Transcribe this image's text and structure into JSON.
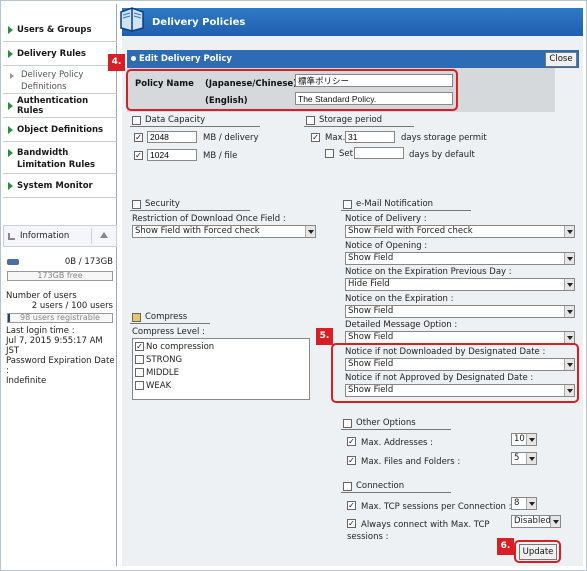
{
  "sidebar": {
    "items": [
      {
        "label": "Users & Groups"
      },
      {
        "label": "Delivery Rules"
      },
      {
        "label": "Delivery Policy Definitions"
      },
      {
        "label": "Authentication Rules"
      },
      {
        "label": "Object Definitions"
      },
      {
        "label": "Bandwidth Limitation Rules"
      },
      {
        "label": "System Monitor"
      }
    ],
    "info": {
      "title": "Information",
      "disk_used": "0B /  173GB",
      "disk_free": "173GB free",
      "users_label": "Number of users",
      "users_value": "2 users / 100 users",
      "users_registrable": "98 users registrable",
      "users_fraction": 0.02,
      "login_label": "Last login time :",
      "login_value": "Jul 7, 2015 9:55:17 AM JST",
      "pwd_label": "Password Expiration Date :",
      "pwd_value": "Indefinite"
    }
  },
  "header": {
    "title": "Delivery Policies"
  },
  "edit": {
    "title": "Edit Delivery Policy",
    "close_label": "Close",
    "policy_name_label": "Policy Name",
    "jp_label": "(Japanese/Chinese)",
    "en_label": "(English)",
    "jp_value": "標準ポリシー",
    "en_value": "The Standard Policy."
  },
  "capacity": {
    "title": "Data Capacity",
    "delivery_value": "2048",
    "delivery_unit": "MB / delivery",
    "file_value": "1024",
    "file_unit": "MB / file"
  },
  "storage": {
    "title": "Storage period",
    "max_label": "Max.",
    "max_value": "31",
    "max_unit": "days storage permit",
    "set_label": "Set",
    "set_value": "",
    "set_unit": "days by default"
  },
  "security": {
    "title": "Security",
    "field_label": "Restriction of Download Once Field :",
    "field_value": "Show Field with Forced check"
  },
  "compress": {
    "title": "Compress",
    "level_label": "Compress Level :",
    "options": [
      "No compression",
      "STRONG",
      "MIDDLE",
      "WEAK"
    ]
  },
  "email": {
    "title": "e-Mail Notification",
    "fields": [
      {
        "label": "Notice of Delivery :",
        "value": "Show Field with Forced check"
      },
      {
        "label": "Notice of Opening :",
        "value": "Show Field"
      },
      {
        "label": "Notice on the Expiration Previous Day :",
        "value": "Hide Field"
      },
      {
        "label": "Notice on the Expiration :",
        "value": "Show Field"
      },
      {
        "label": "Detailed Message Option :",
        "value": "Show Field"
      },
      {
        "label": "Notice if not Downloaded by Designated Date :",
        "value": "Show Field"
      },
      {
        "label": "Notice if not Approved by Designated Date :",
        "value": "Show Field"
      }
    ]
  },
  "other": {
    "title": "Other Options",
    "addr_label": "Max. Addresses :",
    "addr_value": "10",
    "files_label": "Max. Files and Folders :",
    "files_value": "5"
  },
  "connection": {
    "title": "Connection",
    "tcp_label": "Max. TCP sessions per Connection :",
    "tcp_value": "8",
    "always_label_1": "Always connect with Max. TCP",
    "always_label_2": "sessions :",
    "always_value": "Disabled"
  },
  "update_label": "Update",
  "badges": [
    "4.",
    "5.",
    "6."
  ],
  "colors": {
    "accent": "#1f5fae",
    "highlight": "#d81f26"
  }
}
